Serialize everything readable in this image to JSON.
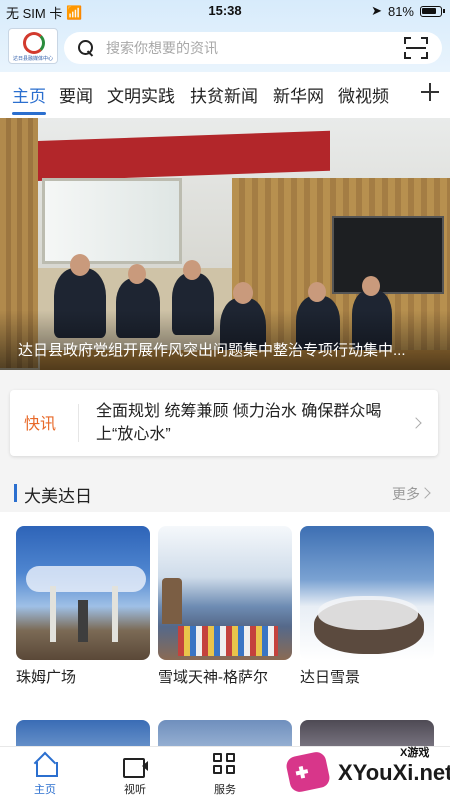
{
  "status_bar": {
    "carrier": "无 SIM 卡",
    "time": "15:38",
    "battery": "81%"
  },
  "header": {
    "logo_text": "达日县融媒体中心",
    "search_placeholder": "搜索你想要的资讯"
  },
  "tabs": [
    {
      "label": "主页",
      "active": true
    },
    {
      "label": "要闻",
      "active": false
    },
    {
      "label": "文明实践",
      "active": false
    },
    {
      "label": "扶贫新闻",
      "active": false
    },
    {
      "label": "新华网",
      "active": false
    },
    {
      "label": "微视频",
      "active": false
    }
  ],
  "hero": {
    "caption": "达日县政府党组开展作风突出问题集中整治专项行动集中..."
  },
  "flash_news": {
    "tag": "快讯",
    "text": "全面规划 统筹兼顾 倾力治水 确保群众喝上“放心水”"
  },
  "section": {
    "title": "大美达日",
    "more": "更多",
    "cards": [
      {
        "label": "珠姆广场"
      },
      {
        "label": "雪域天神-格萨尔"
      },
      {
        "label": "达日雪景"
      }
    ]
  },
  "bottom_nav": [
    {
      "label": "主页",
      "active": true
    },
    {
      "label": "视听",
      "active": false
    },
    {
      "label": "服务",
      "active": false
    }
  ],
  "watermark": {
    "small": "X游戏",
    "big": "XYouXi.net"
  },
  "colors": {
    "accent": "#2b6fcf",
    "flash_tag": "#e86a2a",
    "header_bg": "#d7ebfb"
  }
}
